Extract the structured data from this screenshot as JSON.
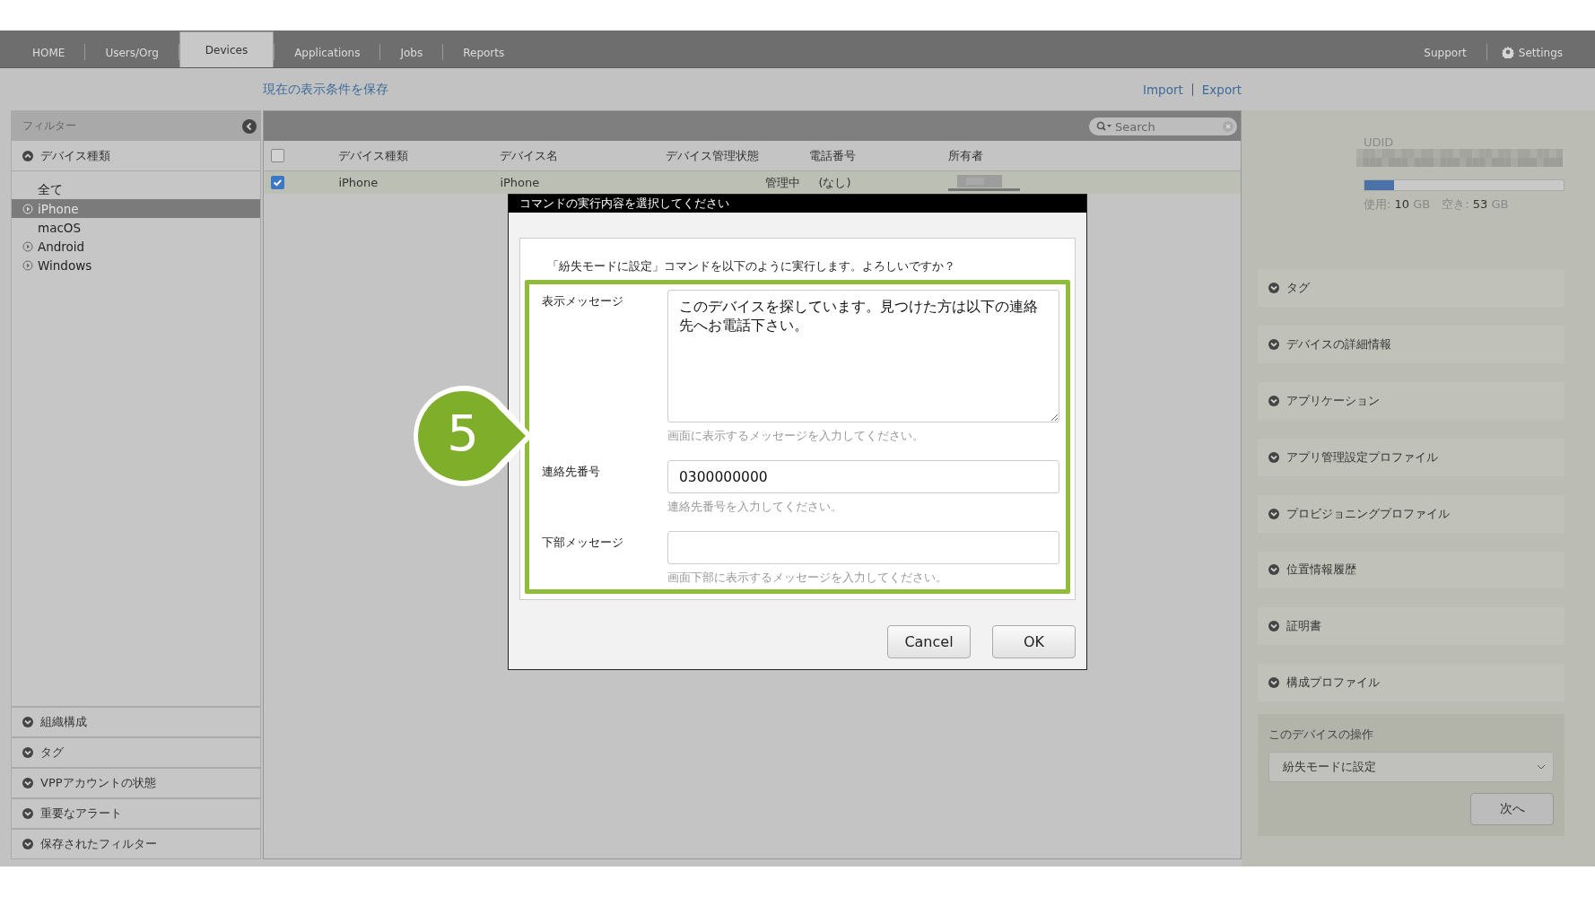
{
  "nav": {
    "tabs": [
      {
        "label": "HOME",
        "selected": false
      },
      {
        "label": "Users/Org",
        "selected": false
      },
      {
        "label": "Devices",
        "selected": true
      },
      {
        "label": "Applications",
        "selected": false
      },
      {
        "label": "Jobs",
        "selected": false
      },
      {
        "label": "Reports",
        "selected": false
      }
    ],
    "support": "Support",
    "settings": "Settings"
  },
  "save_link": "現在の表示条件を保存",
  "import": "Import",
  "export": "Export",
  "filter": {
    "title": "フィルター",
    "group": {
      "label": "デバイス種類",
      "expanded": true
    },
    "items": [
      {
        "label": "全て",
        "marked": false,
        "selected": false
      },
      {
        "label": "iPhone",
        "marked": true,
        "selected": true
      },
      {
        "label": "macOS",
        "marked": false,
        "selected": false
      },
      {
        "label": "Android",
        "marked": true,
        "selected": false
      },
      {
        "label": "Windows",
        "marked": true,
        "selected": false
      }
    ],
    "sections": [
      "組織構成",
      "タグ",
      "VPPアカウントの状態",
      "重要なアラート",
      "保存されたフィルター"
    ]
  },
  "search": {
    "placeholder": "Search"
  },
  "table": {
    "all_checked": false,
    "columns": [
      "デバイス種類",
      "デバイス名",
      "デバイス管理状態",
      "電話番号",
      "所有者"
    ],
    "rows": [
      {
        "checked": true,
        "cells": [
          "iPhone",
          "iPhone",
          "管理中",
          "(なし)"
        ]
      }
    ]
  },
  "device": {
    "udid_label": "UDID",
    "storage": {
      "level": 0.15,
      "reading": "使用: **10** GB　空き: **53** GB"
    },
    "sections": [
      "タグ",
      "デバイスの詳細情報",
      "アプリケーション",
      "アプリ管理設定プロファイル",
      "プロビジョニングプロファイル",
      "位置情報履歴",
      "証明書",
      "構成プロファイル"
    ],
    "actions": {
      "title": "このデバイスの操作",
      "select": "紛失モードに設定",
      "next": "次へ"
    }
  },
  "dialog": {
    "title": "コマンドの実行内容を選択してください",
    "question": "「紛失モードに設定」コマンドを以下のように実行します。よろしいですか？",
    "fields": [
      {
        "kind": "textarea",
        "label": "表示メッセージ",
        "value": "このデバイスを探しています。見つけた方は以下の連絡先へお電話下さい。",
        "hint": "画面に表示するメッセージを入力してください。"
      },
      {
        "kind": "text",
        "label": "連絡先番号",
        "value": "0300000000",
        "hint": "連絡先番号を入力してください。"
      },
      {
        "kind": "text",
        "label": "下部メッセージ",
        "hint": "画面下部に表示するメッセージを入力してください。"
      }
    ],
    "cancel": "Cancel",
    "ok": "OK"
  },
  "step": "5"
}
